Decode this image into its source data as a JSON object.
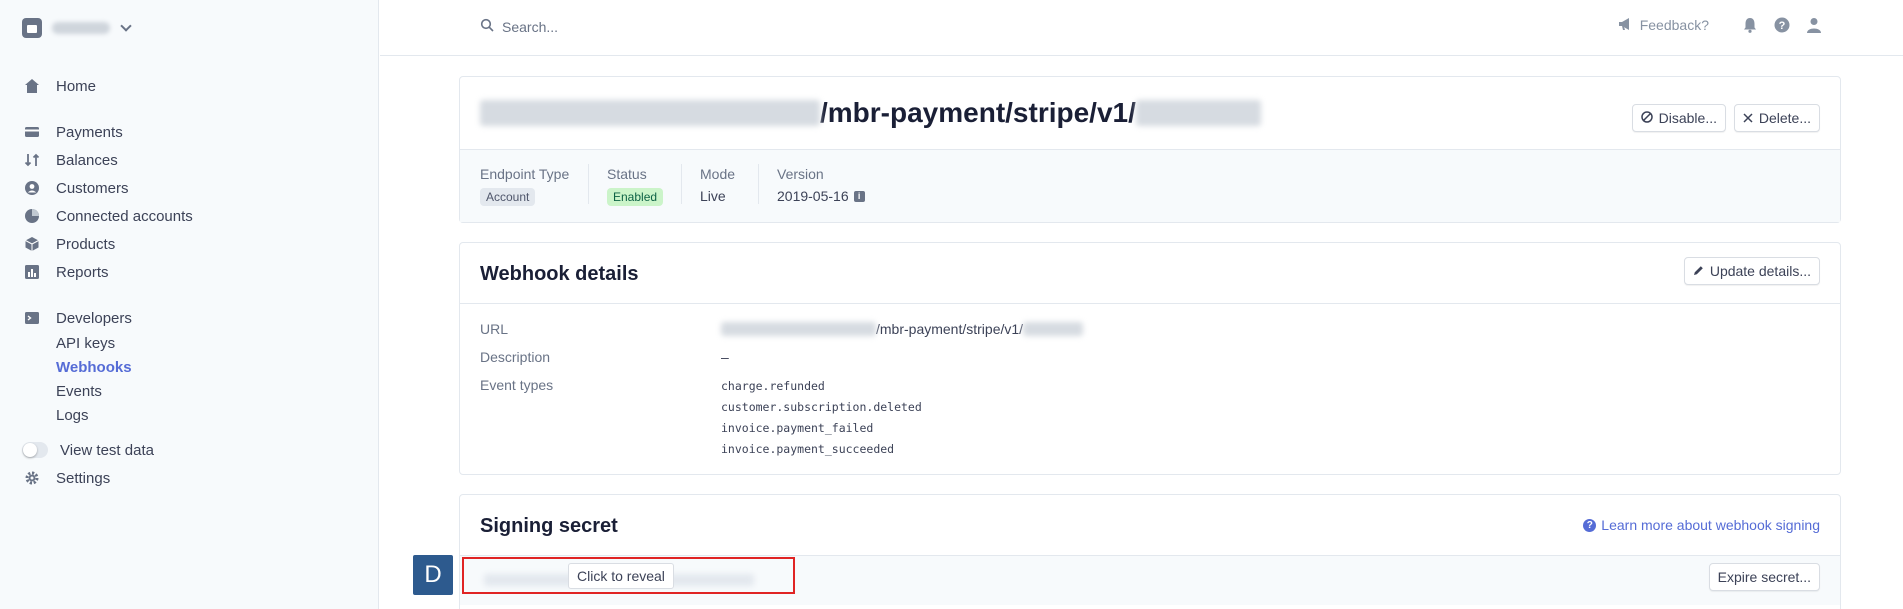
{
  "sidebar": {
    "nav": [
      {
        "label": "Home",
        "icon": "home-icon"
      },
      {
        "label": "Payments",
        "icon": "payments-icon"
      },
      {
        "label": "Balances",
        "icon": "balances-icon"
      },
      {
        "label": "Customers",
        "icon": "customers-icon"
      },
      {
        "label": "Connected accounts",
        "icon": "connected-accounts-icon"
      },
      {
        "label": "Products",
        "icon": "products-icon"
      },
      {
        "label": "Reports",
        "icon": "reports-icon"
      },
      {
        "label": "Developers",
        "icon": "developers-icon"
      }
    ],
    "developers_sub": [
      "API keys",
      "Webhooks",
      "Events",
      "Logs"
    ],
    "view_test_data": "View test data",
    "settings": "Settings"
  },
  "topbar": {
    "search_placeholder": "Search...",
    "feedback": "Feedback?"
  },
  "endpoint": {
    "url_visible": "/mbr-payment/stripe/v1/",
    "disable_button": "Disable...",
    "delete_button": "Delete...",
    "meta": {
      "endpoint_type_label": "Endpoint Type",
      "endpoint_type_value": "Account",
      "status_label": "Status",
      "status_value": "Enabled",
      "mode_label": "Mode",
      "mode_value": "Live",
      "version_label": "Version",
      "version_value": "2019-05-16"
    }
  },
  "webhook_details": {
    "title": "Webhook details",
    "update_button": "Update details...",
    "url_label": "URL",
    "url_visible": "/mbr-payment/stripe/v1/",
    "description_label": "Description",
    "description_value": "–",
    "event_types_label": "Event types",
    "event_types": [
      "charge.refunded",
      "customer.subscription.deleted",
      "invoice.payment_failed",
      "invoice.payment_succeeded"
    ]
  },
  "signing_secret": {
    "title": "Signing secret",
    "learn_more": "Learn more about webhook signing",
    "reveal_button": "Click to reveal",
    "expire_button": "Expire secret..."
  },
  "overlay": {
    "avatar_letter": "D"
  },
  "colors": {
    "accent": "#556cd6",
    "highlight_border": "#e02424",
    "avatar_bg": "#2d5a8e"
  }
}
